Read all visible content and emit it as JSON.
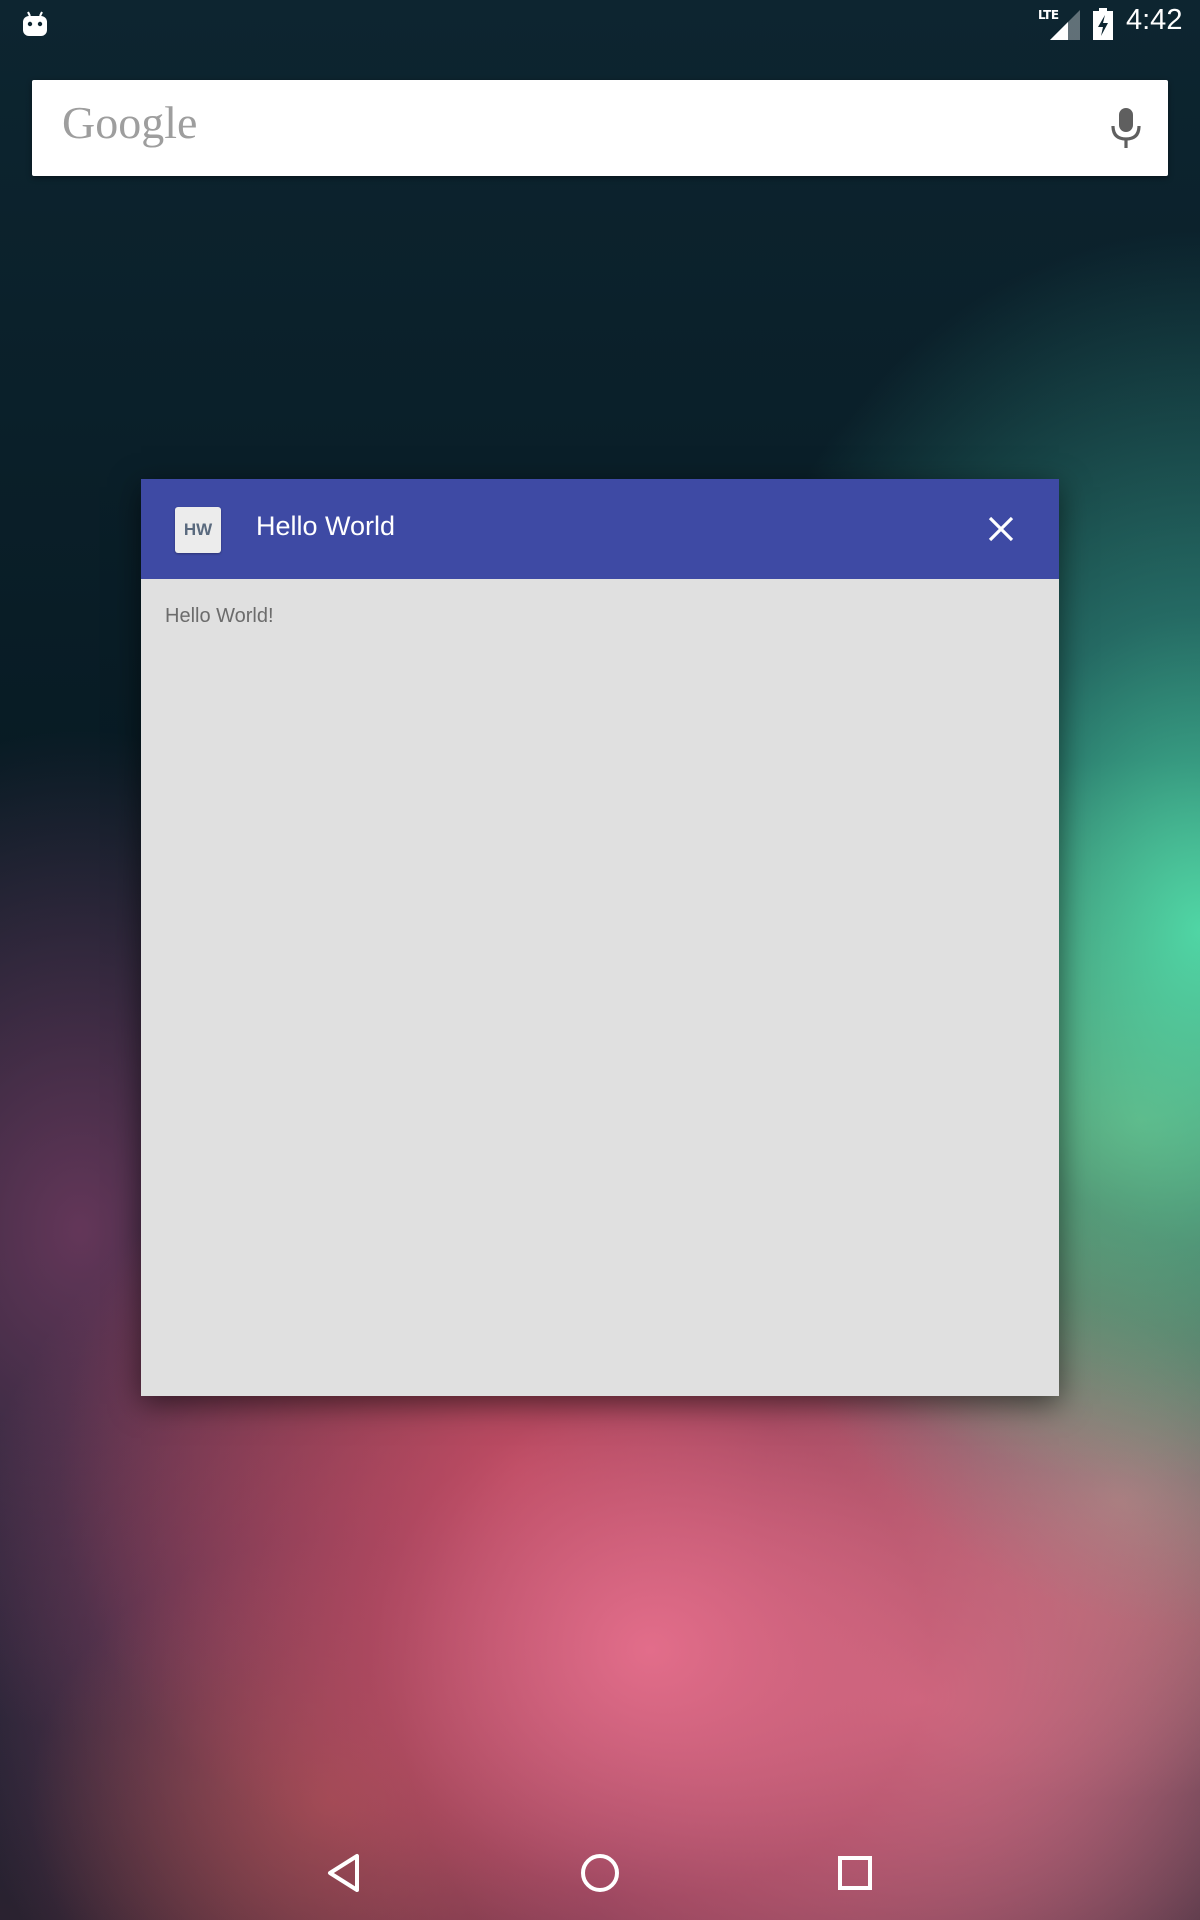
{
  "status_bar": {
    "network_label": "LTE",
    "time": "4:42",
    "icons": [
      "android-notification-icon",
      "lte-signal-icon",
      "battery-charging-icon"
    ]
  },
  "search_bar": {
    "logo_text": "Google",
    "mic_icon": "mic-icon"
  },
  "dialog": {
    "app_icon_text": "HW",
    "title": "Hello World",
    "close_icon": "close-icon",
    "body_text": "Hello World!",
    "header_color": "#3e4aa4",
    "body_color": "#e0e0e0"
  },
  "nav_bar": {
    "icons": [
      "back-icon",
      "home-icon",
      "recents-icon"
    ]
  }
}
